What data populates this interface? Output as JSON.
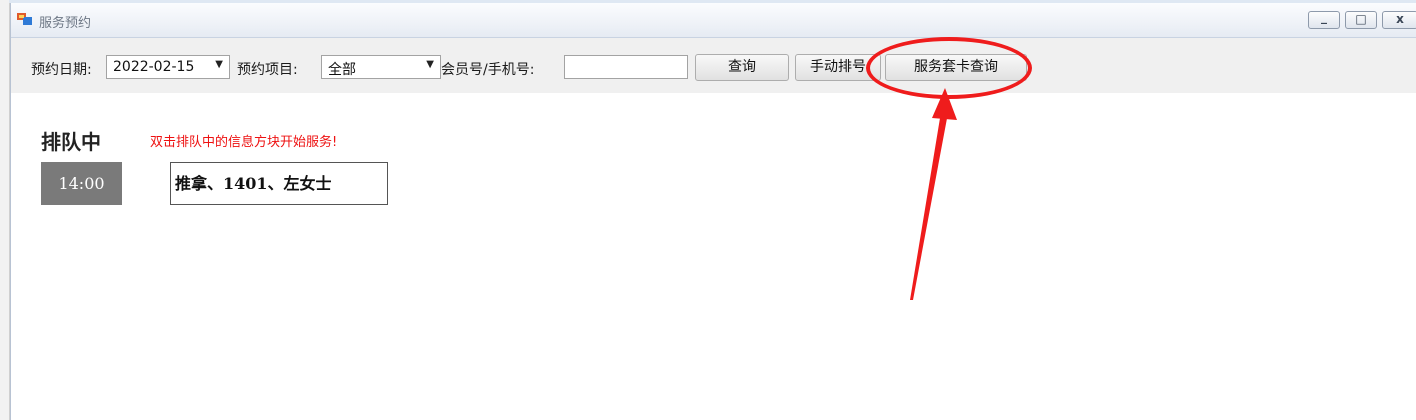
{
  "window": {
    "title": "服务预约",
    "controls": {
      "minimize": "_",
      "maximize": "□",
      "close": "x"
    }
  },
  "toolbar": {
    "date_label": "预约日期:",
    "date_value": "2022-02-15",
    "project_label": "预约项目:",
    "project_value": "全部",
    "member_label": "会员号/手机号:",
    "member_value": "",
    "query_button": "查询",
    "manual_button": "手动排号",
    "card_query_button": "服务套卡查询"
  },
  "queue": {
    "title": "排队中",
    "hint": "双击排队中的信息方块开始服务!",
    "items": [
      {
        "time": "14:00",
        "info": "推拿、1401、左女士"
      }
    ]
  },
  "annotation": {
    "color": "#ef1c1c"
  },
  "icons": {
    "app": "window-app-icon",
    "dropdown": "chevron-down-icon"
  }
}
